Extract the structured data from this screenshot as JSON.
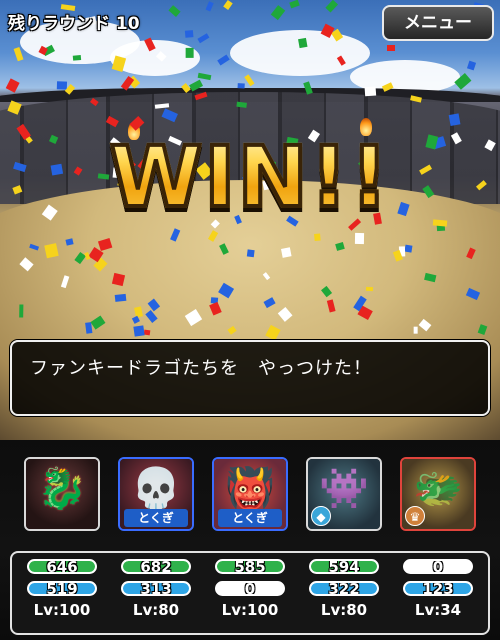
{
  "header": {
    "round_label": "残りラウンド 10",
    "menu_label": "メニュー"
  },
  "banner": {
    "text": "WIN!!"
  },
  "message": {
    "text": "ファンキードラゴたちを　やっつけた！"
  },
  "party": [
    {
      "portrait_icon": "black-dragon-icon",
      "tag": "",
      "badge": "",
      "hp": 646,
      "hp_fraction": 1.0,
      "mp": 519,
      "mp_fraction": 1.0,
      "level": "Lv:100",
      "frame_color": "#d9d9d9"
    },
    {
      "portrait_icon": "armored-beast-icon",
      "tag": "とくぎ",
      "badge": "",
      "hp": 682,
      "hp_fraction": 1.0,
      "mp": 313,
      "mp_fraction": 1.0,
      "level": "Lv:80",
      "frame_color": "#3a6cff"
    },
    {
      "portrait_icon": "demon-bishop-icon",
      "tag": "とくぎ",
      "badge": "",
      "hp": 585,
      "hp_fraction": 1.0,
      "mp": 0,
      "mp_fraction": 0.0,
      "level": "Lv:100",
      "frame_color": "#3a6cff"
    },
    {
      "portrait_icon": "teal-beast-icon",
      "tag": "",
      "badge": "diamond-icon",
      "hp": 594,
      "hp_fraction": 1.0,
      "mp": 322,
      "mp_fraction": 1.0,
      "level": "Lv:80",
      "frame_color": "#d9d9d9"
    },
    {
      "portrait_icon": "fallen-warrior-icon",
      "tag": "",
      "badge": "crown-icon",
      "hp": 0,
      "hp_fraction": 0.0,
      "mp": 123,
      "mp_fraction": 1.0,
      "level": "Lv:34",
      "frame_color": "#e0443c"
    }
  ],
  "colors": {
    "hp_fill": "#2fb24b",
    "mp_fill": "#2ea5e6",
    "win_gold": "#ffd54d"
  }
}
